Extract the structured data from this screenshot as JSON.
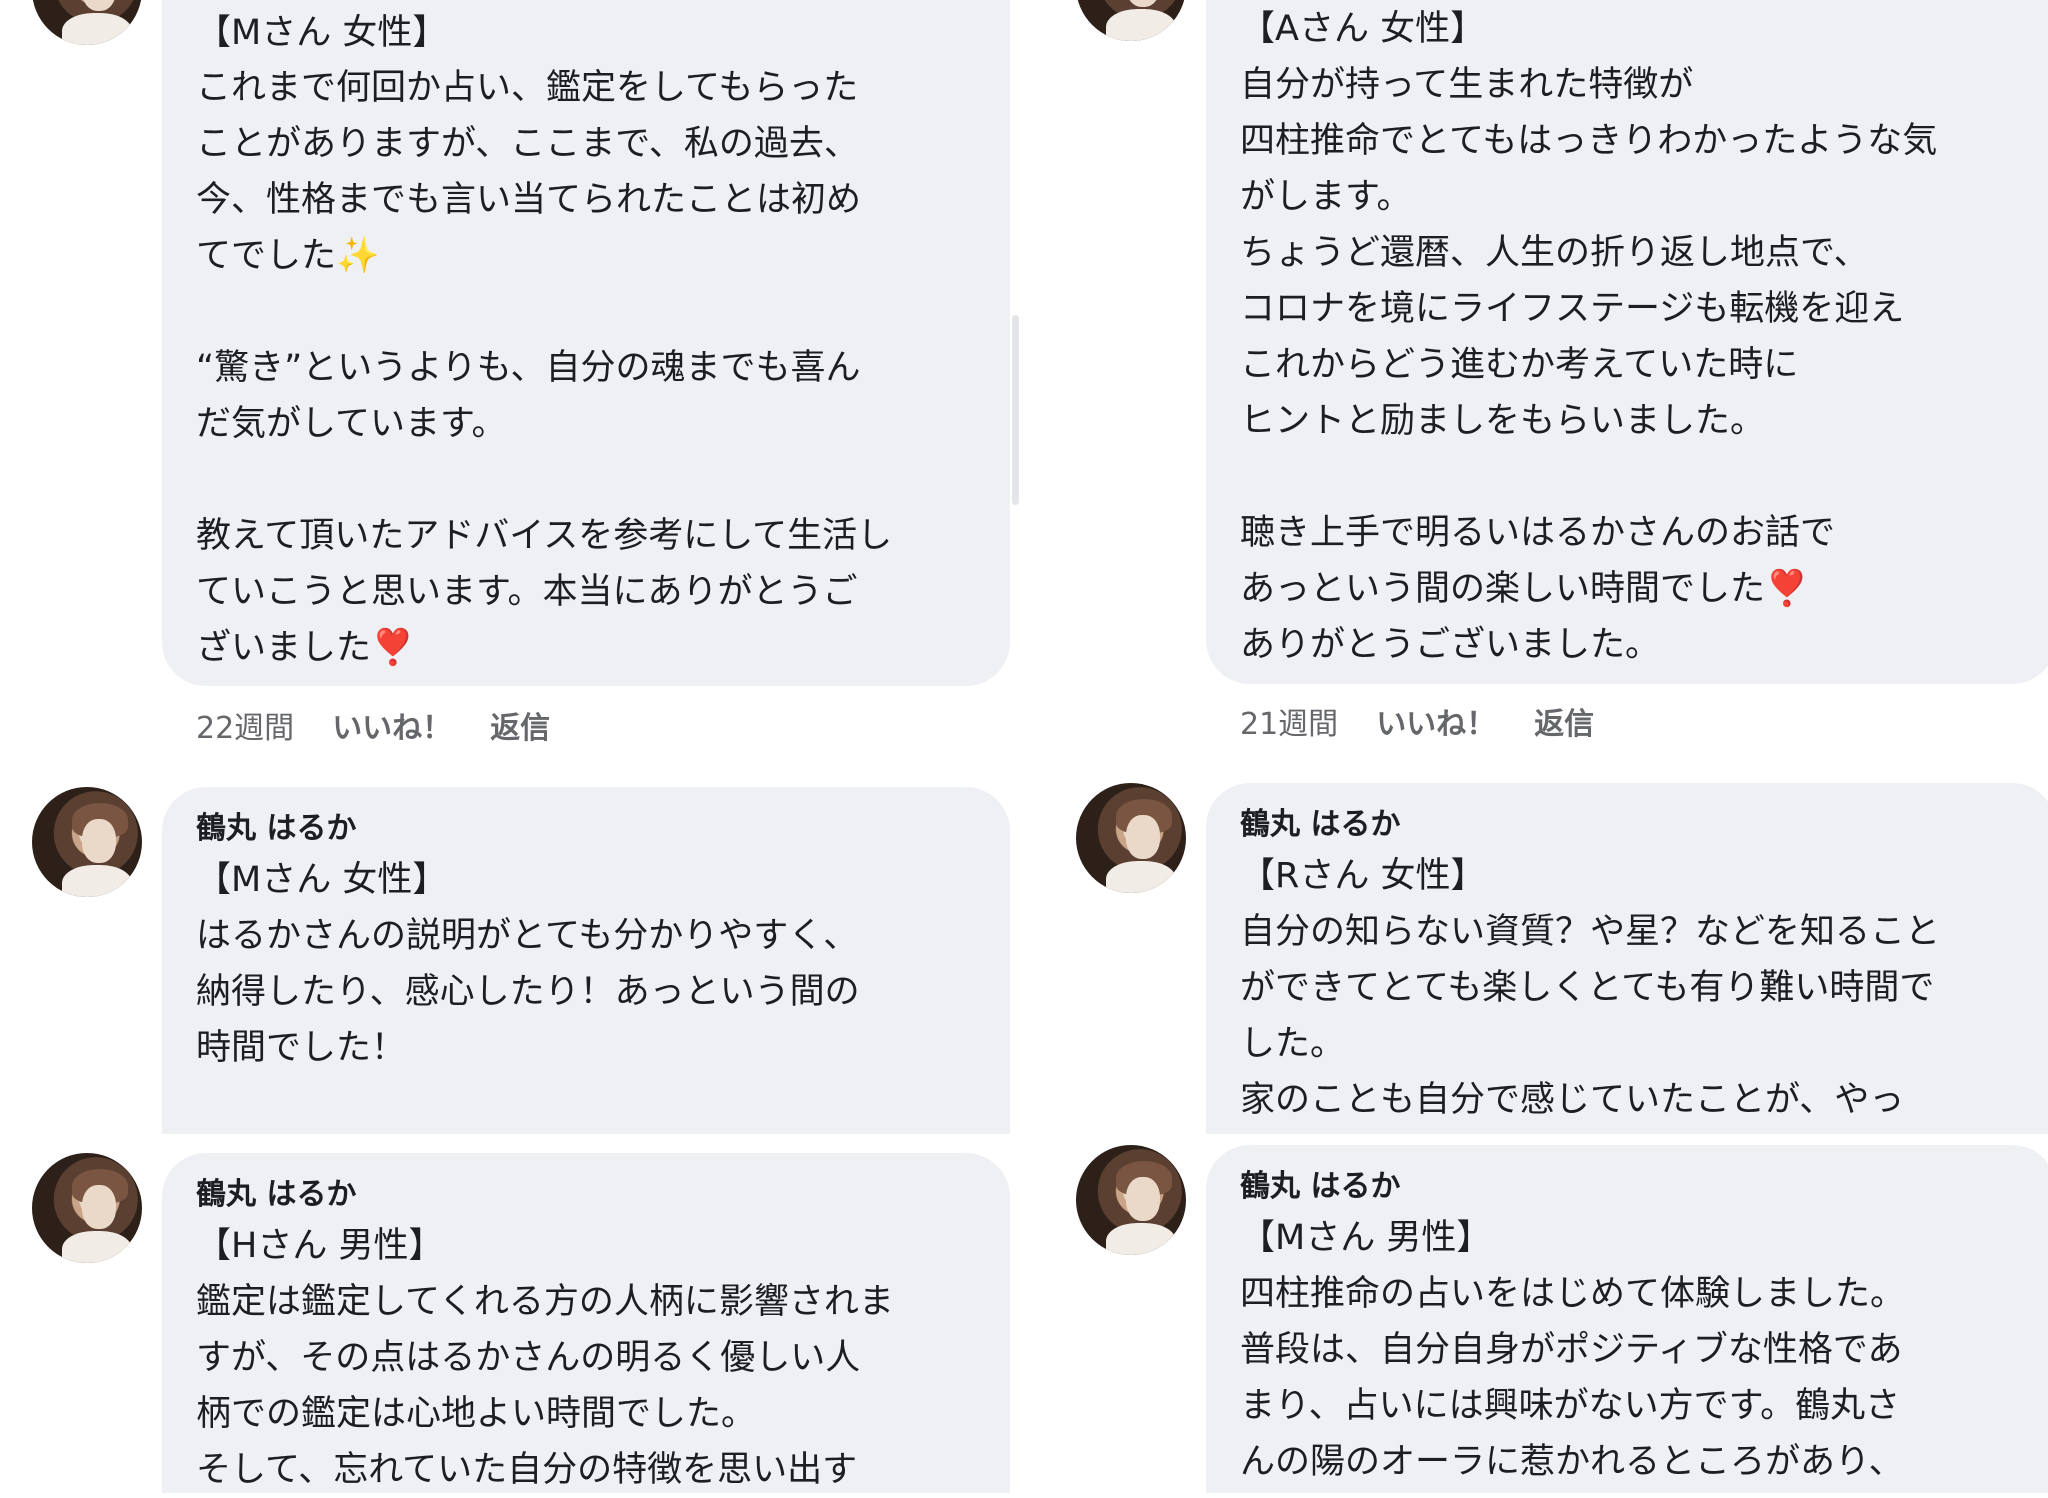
{
  "comments": [
    {
      "tag": "【Mさん 女性】",
      "lines": [
        "これまで何回か占い、鑑定をしてもらった",
        "ことがありますが、ここまで、私の過去、",
        "今、性格までも言い当てられたことは初め",
        "てでした✨",
        "",
        "“驚き”というよりも、自分の魂までも喜ん",
        "だ気がしています。",
        "",
        "教えて頂いたアドバイスを参考にして生活し",
        "ていこうと思います。本当にありがとうご",
        "ざいました❣️"
      ],
      "time": "22週間",
      "like": "いいね！",
      "reply": "返信"
    },
    {
      "tag": "【Aさん 女性】",
      "lines": [
        "自分が持って生まれた特徴が",
        "四柱推命でとてもはっきりわかったような気",
        "がします。",
        "ちょうど還暦、人生の折り返し地点で、",
        "コロナを境にライフステージも転機を迎え",
        "これからどう進むか考えていた時に",
        "ヒントと励ましをもらいました。",
        "",
        "聴き上手で明るいはるかさんのお話で",
        "あっという間の楽しい時間でした❣️",
        "ありがとうございました。"
      ],
      "time": "21週間",
      "like": "いいね！",
      "reply": "返信"
    },
    {
      "name": "鶴丸 はるか",
      "tag": "【Mさん 女性】",
      "lines": [
        "はるかさんの説明がとても分かりやすく、",
        "納得したり、感心したり！あっという間の",
        "時間でした！"
      ]
    },
    {
      "name": "鶴丸 はるか",
      "tag": "【Rさん 女性】",
      "lines": [
        "自分の知らない資質？や星？などを知ること",
        "ができてとても楽しくとても有り難い時間で",
        "した。",
        "家のことも自分で感じていたことが、やっ"
      ]
    },
    {
      "name": "鶴丸 はるか",
      "tag": "【Hさん 男性】",
      "lines": [
        "鑑定は鑑定してくれる方の人柄に影響されま",
        "すが、その点はるかさんの明るく優しい人",
        "柄での鑑定は心地よい時間でした。",
        "そして、忘れていた自分の特徴を思い出す"
      ]
    },
    {
      "name": "鶴丸 はるか",
      "tag": "【Mさん 男性】",
      "lines": [
        "四柱推命の占いをはじめて体験しました。",
        "普段は、自分自身がポジティブな性格であ",
        "まり、占いには興味がない方です。鶴丸さ",
        "んの陽のオーラに惹かれるところがあり、"
      ]
    }
  ]
}
